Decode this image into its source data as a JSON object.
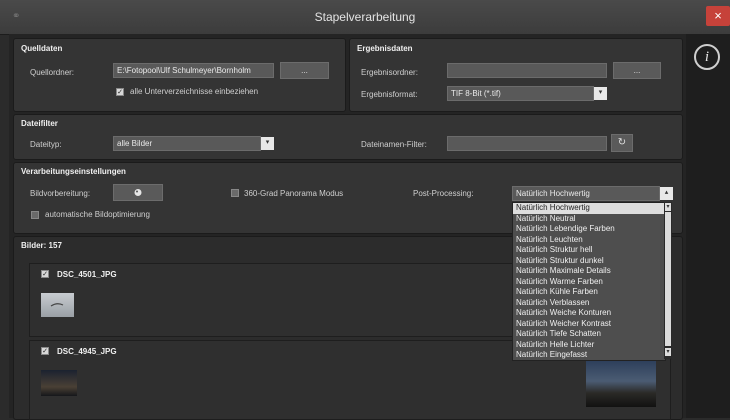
{
  "window": {
    "title": "Stapelverarbeitung",
    "close": "×"
  },
  "quelldaten": {
    "title": "Quelldaten",
    "folder_label": "Quellordner:",
    "folder_value": "E:\\Fotopool\\Ulf Schulmeyer\\Bornholm",
    "browse": "...",
    "subdirs_label": "alle Unterverzeichnisse einbeziehen",
    "subdirs_checked": true
  },
  "ergebnisdaten": {
    "title": "Ergebnisdaten",
    "folder_label": "Ergebnisordner:",
    "folder_value": "",
    "browse": "...",
    "format_label": "Ergebnisformat:",
    "format_value": "TIF 8-Bit (*.tif)"
  },
  "dateifilter": {
    "title": "Dateifilter",
    "type_label": "Dateityp:",
    "type_value": "alle Bilder",
    "name_filter_label": "Dateinamen-Filter:",
    "name_filter_value": ""
  },
  "verarbeitung": {
    "title": "Verarbeitungseinstellungen",
    "bildvorbereitung_label": "Bildvorbereitung:",
    "panorama_label": "360-Grad Panorama Modus",
    "panorama_checked": false,
    "auto_opt_label": "automatische Bildoptimierung",
    "auto_opt_checked": false,
    "postprocessing_label": "Post-Processing:",
    "postprocessing_value": "Natürlich Hochwertig",
    "postprocessing_options": [
      "Natürlich Hochwertig",
      "Natürlich Neutral",
      "Natürlich Lebendige Farben",
      "Natürlich Leuchten",
      "Natürlich Struktur hell",
      "Natürlich Struktur dunkel",
      "Natürlich Maximale Details",
      "Natürlich Warme Farben",
      "Natürlich Kühle Farben",
      "Natürlich Verblassen",
      "Natürlich Weiche Konturen",
      "Natürlich Weicher Kontrast",
      "Natürlich Tiefe Schatten",
      "Natürlich Helle Lichter",
      "Natürlich Eingefasst"
    ]
  },
  "bilder": {
    "label": "Bilder: 157",
    "items": [
      {
        "name": "DSC_4501_JPG",
        "checked": true
      },
      {
        "name": "DSC_4945_JPG",
        "checked": true
      }
    ]
  },
  "icons": {
    "info": "i",
    "refresh": "↻",
    "dropdown": "▾",
    "app": "⚭"
  }
}
